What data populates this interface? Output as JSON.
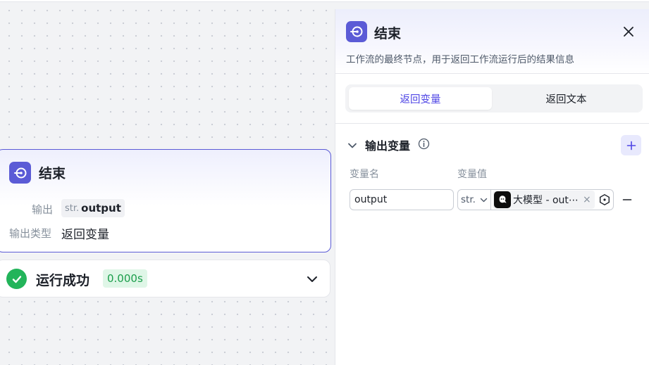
{
  "canvas_node": {
    "title": "结束",
    "output_label": "输出",
    "output_tag_type": "str.",
    "output_tag_name": "output",
    "type_label": "输出类型",
    "type_value": "返回变量"
  },
  "run_status": {
    "text": "运行成功",
    "duration": "0.000s"
  },
  "panel": {
    "title": "结束",
    "description": "工作流的最终节点，用于返回工作流运行后的结果信息",
    "tabs": [
      {
        "label": "返回变量",
        "active": true
      },
      {
        "label": "返回文本",
        "active": false
      }
    ],
    "section_title": "输出变量",
    "columns": {
      "name": "变量名",
      "value": "变量值"
    },
    "variables": [
      {
        "name": "output",
        "type": "str.",
        "reference": "大模型 - out⋯"
      }
    ]
  },
  "colors": {
    "accent": "#5b5bd6",
    "success": "#22b45a",
    "success_bg": "#dff6e7"
  }
}
